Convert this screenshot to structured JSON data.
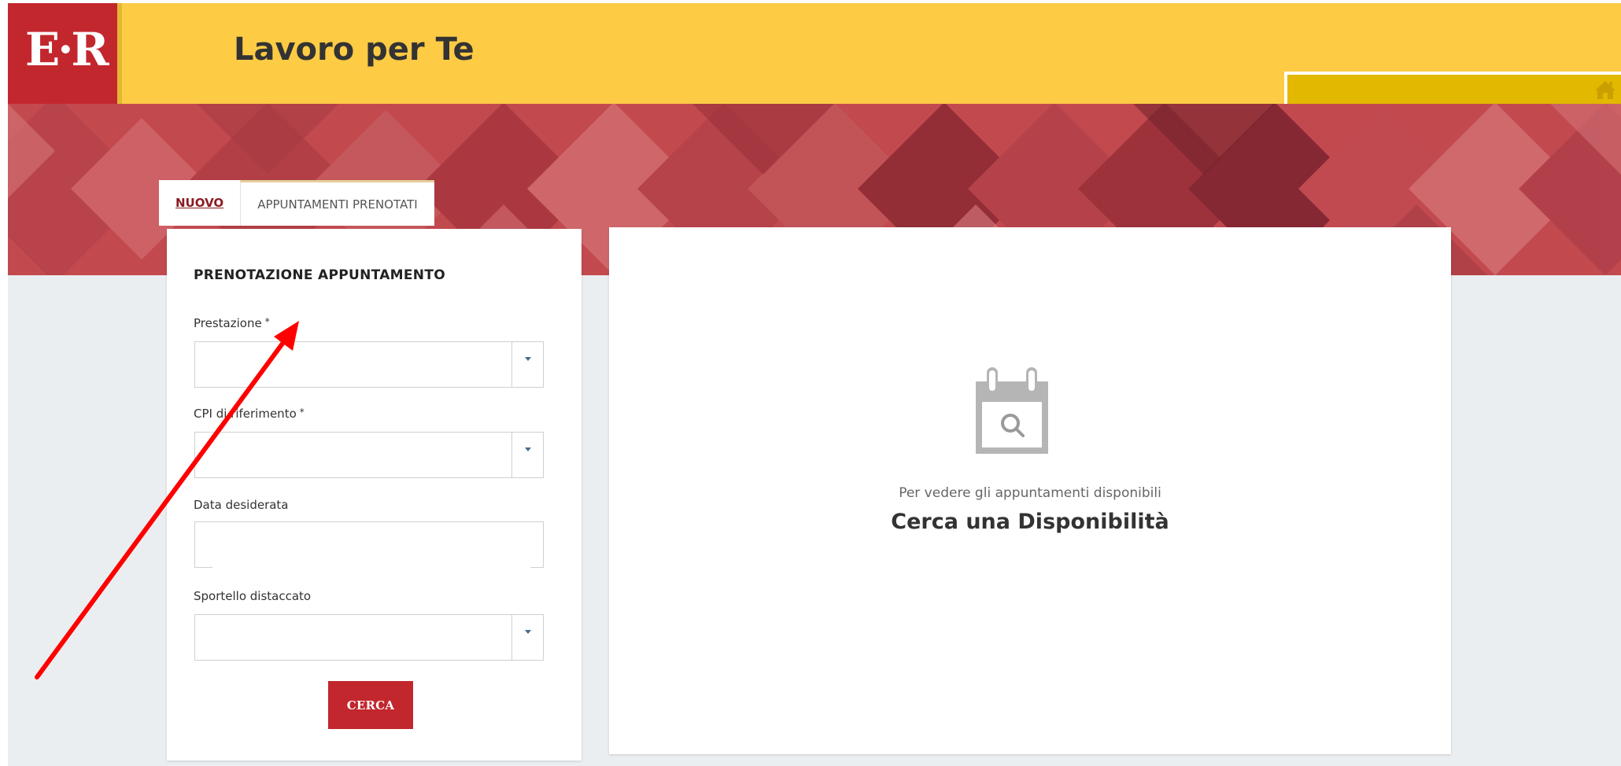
{
  "header": {
    "logo_text": "E·R",
    "title": "Lavoro per Te",
    "home_icon": "home-icon"
  },
  "tabs": [
    {
      "label": "NUOVO",
      "active": true
    },
    {
      "label": "APPUNTAMENTI PRENOTATI",
      "active": false
    }
  ],
  "form": {
    "title": "PRENOTAZIONE APPUNTAMENTO",
    "fields": [
      {
        "label": "Prestazione",
        "required_mark": "*",
        "type": "select",
        "value": ""
      },
      {
        "label": "CPI di riferimento",
        "required_mark": "*",
        "type": "select",
        "value": ""
      },
      {
        "label": "Data desiderata",
        "required_mark": "",
        "type": "date",
        "value": ""
      },
      {
        "label": "Sportello distaccato",
        "required_mark": "",
        "type": "select",
        "value": ""
      }
    ],
    "submit_label": "CERCA"
  },
  "results": {
    "icon": "calendar-search-icon",
    "hint": "Per vedere gli appuntamenti disponibili",
    "cta": "Cerca una Disponibilità"
  },
  "colors": {
    "header_yellow": "#fecb45",
    "brand_red": "#c3272e",
    "banner_red": "#c1474c",
    "annotation_red": "#ff0000"
  }
}
